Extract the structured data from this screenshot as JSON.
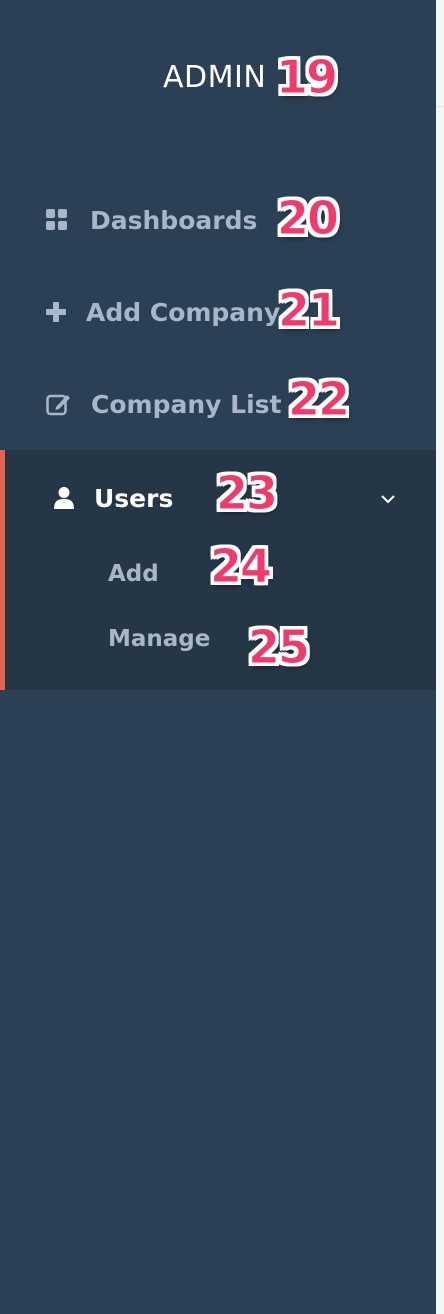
{
  "brand": {
    "title": "ADMIN"
  },
  "nav": {
    "dashboards": {
      "label": "Dashboards",
      "icon": "dashboard-grid-icon"
    },
    "add_company": {
      "label": "Add Company",
      "icon": "plus-icon"
    },
    "company_list": {
      "label": "Company List",
      "icon": "edit-icon"
    }
  },
  "users": {
    "label": "Users",
    "icon": "user-icon",
    "expanded": true,
    "items": [
      {
        "label": "Add"
      },
      {
        "label": "Manage"
      }
    ]
  },
  "annotations": [
    "19",
    "20",
    "21",
    "22",
    "23",
    "24",
    "25"
  ],
  "colors": {
    "sidebar_bg": "#2c4055",
    "active_bg": "#253747",
    "accent": "#e8604f",
    "muted_text": "#a9b6c8",
    "badge": "#ef3a6b"
  }
}
